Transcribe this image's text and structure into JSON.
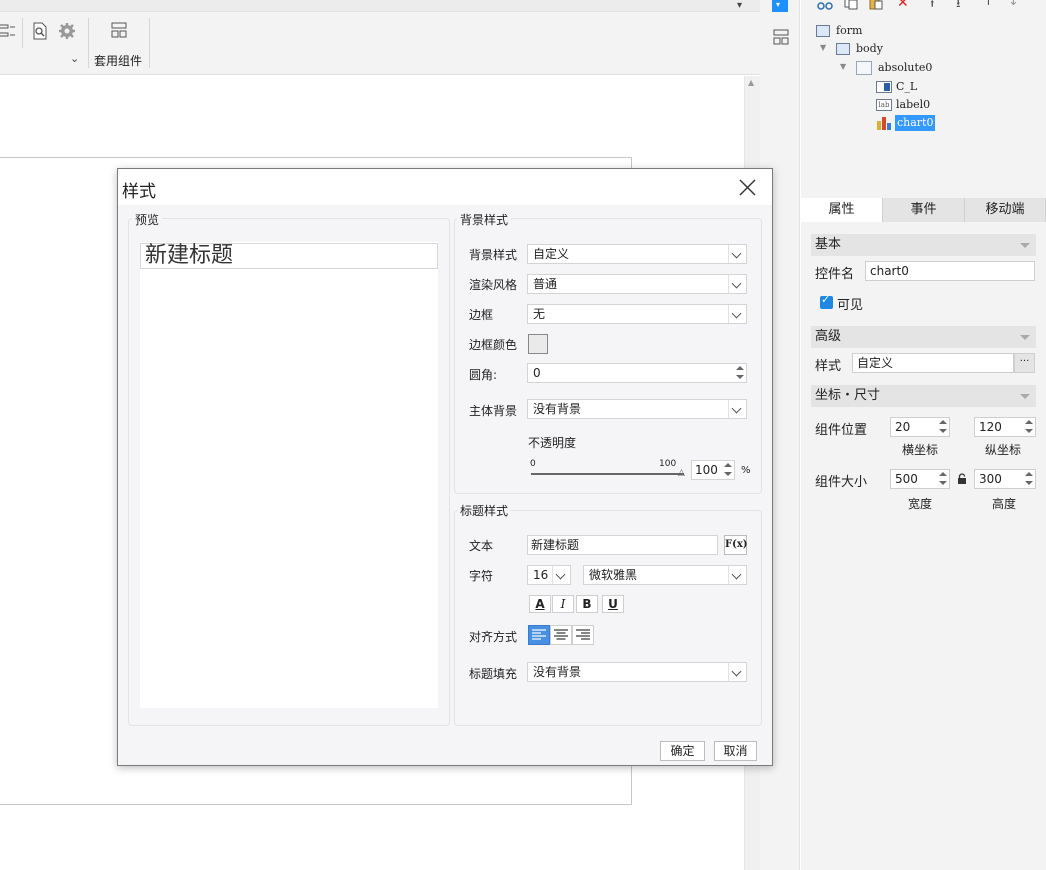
{
  "toolbar": {
    "template_components_label": "套用组件"
  },
  "tree": {
    "items": [
      {
        "label": "form"
      },
      {
        "label": "body"
      },
      {
        "label": "absolute0"
      },
      {
        "label": "C_L"
      },
      {
        "label": "label0"
      },
      {
        "label": "chart0"
      }
    ],
    "selected": "chart0"
  },
  "panel_tabs": [
    "属性",
    "事件",
    "移动端"
  ],
  "properties": {
    "basic_section": "基本",
    "control_name_label": "控件名",
    "control_name_value": "chart0",
    "visible_label": "可见",
    "advanced_section": "高级",
    "style_label": "样式",
    "style_value": "自定义",
    "style_more": "···",
    "coords_section": "坐标・尺寸",
    "position_label": "组件位置",
    "pos_x": "20",
    "pos_y": "120",
    "x_caption": "横坐标",
    "y_caption": "纵坐标",
    "size_label": "组件大小",
    "width": "500",
    "height": "300",
    "width_caption": "宽度",
    "height_caption": "高度"
  },
  "dialog": {
    "title": "样式",
    "preview_group": "预览",
    "preview_text": "新建标题",
    "bg_group": "背景样式",
    "bg_style_label": "背景样式",
    "bg_style_value": "自定义",
    "render_label": "渲染风格",
    "render_value": "普通",
    "border_label": "边框",
    "border_value": "无",
    "border_color_label": "边框颜色",
    "radius_label": "圆角:",
    "radius_value": "0",
    "body_bg_label": "主体背景",
    "body_bg_value": "没有背景",
    "opacity_label": "不透明度",
    "opacity_min": "0",
    "opacity_max": "100",
    "opacity_value": "100",
    "opacity_unit": "%",
    "title_group": "标题样式",
    "text_label": "文本",
    "text_value": "新建标题",
    "fx_label": "F(x)",
    "font_label": "字符",
    "font_size": "16",
    "font_name": "微软雅黑",
    "fmt_color": "A",
    "fmt_italic": "I",
    "fmt_bold": "B",
    "fmt_underline": "U",
    "align_label": "对齐方式",
    "title_fill_label": "标题填充",
    "title_fill_value": "没有背景",
    "ok": "确定",
    "cancel": "取消"
  },
  "colors": {
    "accent": "#1e90ff",
    "selected_bg": "#3399ff",
    "align_active": "#4a90e2"
  }
}
